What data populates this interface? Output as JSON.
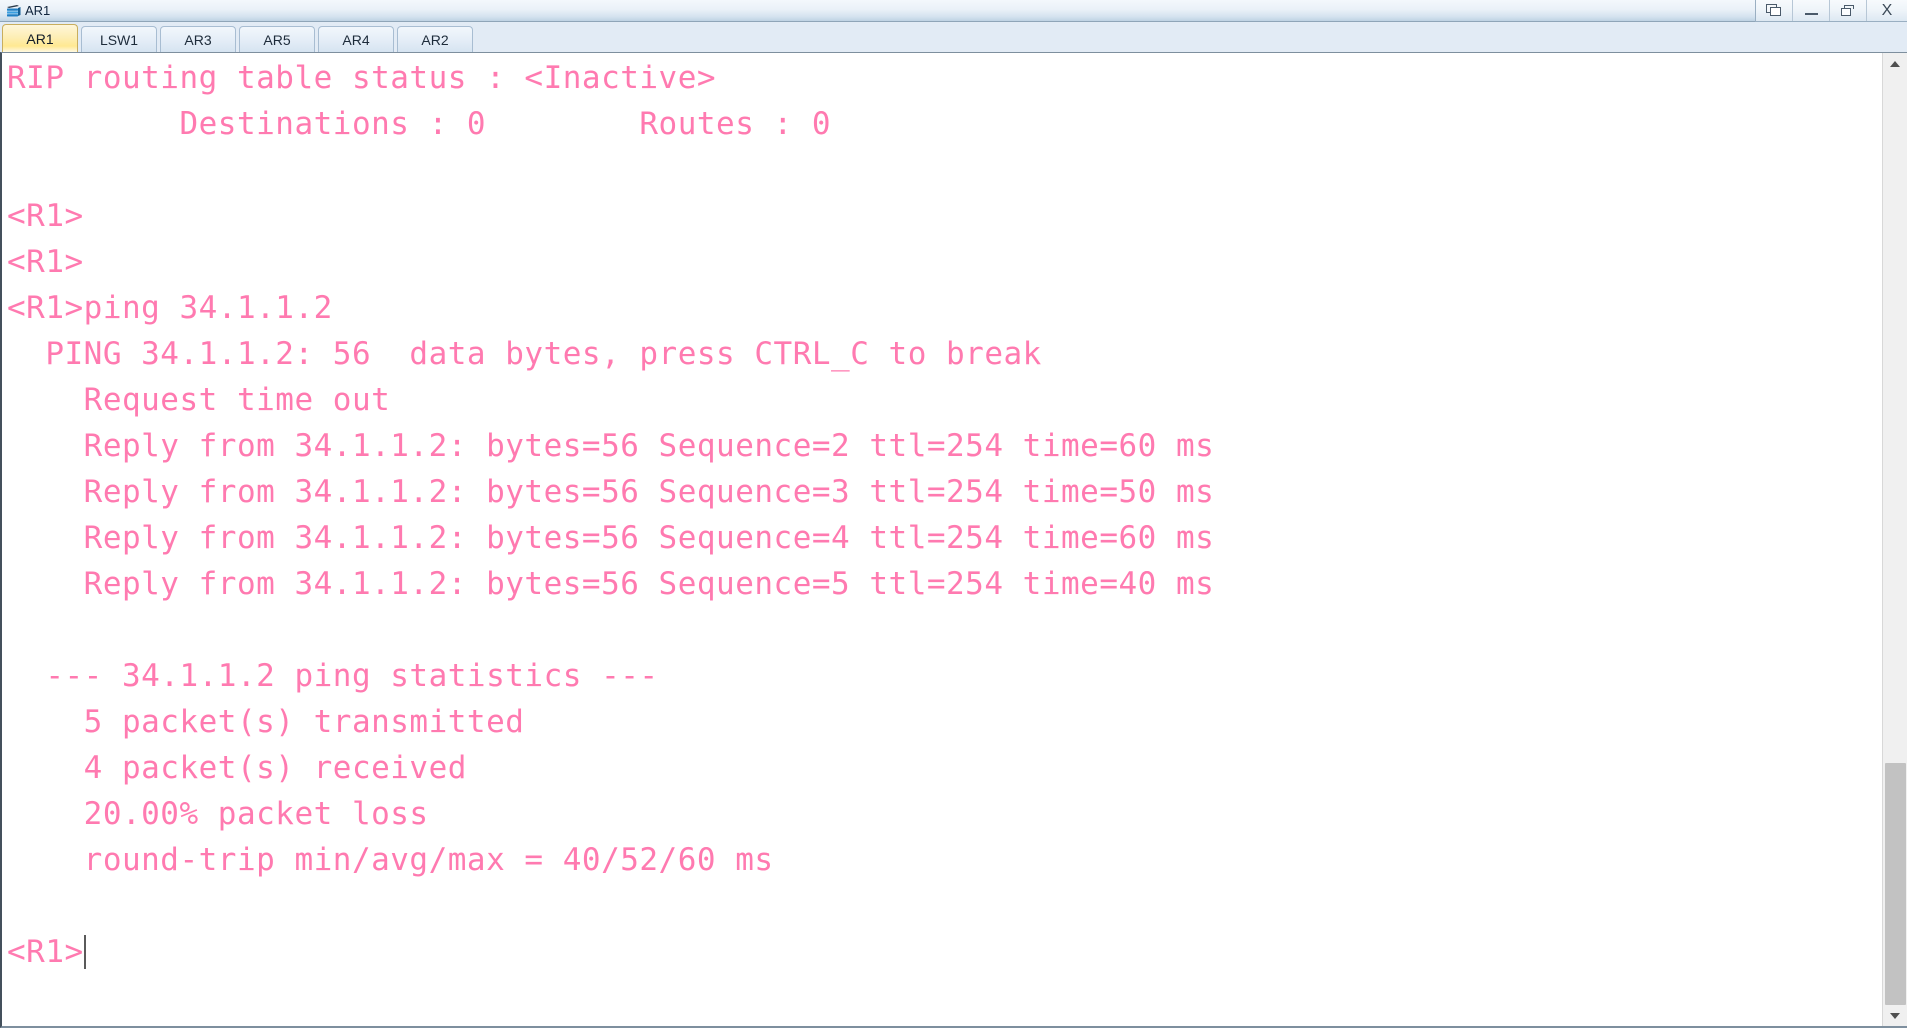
{
  "window": {
    "title": "AR1",
    "icon": "router-icon",
    "controls": [
      {
        "name": "cascade-windows-button",
        "label": "",
        "icon": "cascade-windows-icon"
      },
      {
        "name": "minimize-button",
        "label": "",
        "icon": "minimize-icon"
      },
      {
        "name": "restore-button",
        "label": "",
        "icon": "restore-icon"
      },
      {
        "name": "close-button",
        "label": "X",
        "icon": "close-icon"
      }
    ]
  },
  "tabs": [
    {
      "label": "AR1",
      "active": true
    },
    {
      "label": "LSW1",
      "active": false
    },
    {
      "label": "AR3",
      "active": false
    },
    {
      "label": "AR5",
      "active": false
    },
    {
      "label": "AR4",
      "active": false
    },
    {
      "label": "AR2",
      "active": false
    }
  ],
  "terminal": {
    "text_color": "#ff7ab0",
    "background_color": "#ffffff",
    "lines": [
      "RIP routing table status : <Inactive>",
      "         Destinations : 0        Routes : 0",
      "",
      "<R1>",
      "<R1>",
      "<R1>ping 34.1.1.2",
      "  PING 34.1.1.2: 56  data bytes, press CTRL_C to break",
      "    Request time out",
      "    Reply from 34.1.1.2: bytes=56 Sequence=2 ttl=254 time=60 ms",
      "    Reply from 34.1.1.2: bytes=56 Sequence=3 ttl=254 time=50 ms",
      "    Reply from 34.1.1.2: bytes=56 Sequence=4 ttl=254 time=60 ms",
      "    Reply from 34.1.1.2: bytes=56 Sequence=5 ttl=254 time=40 ms",
      "",
      "  --- 34.1.1.2 ping statistics ---",
      "    5 packet(s) transmitted",
      "    4 packet(s) received",
      "    20.00% packet loss",
      "    round-trip min/avg/max = 40/52/60 ms",
      ""
    ],
    "prompt": "<R1>"
  },
  "scrollbar": {
    "up_arrow": "scroll-up-icon",
    "down_arrow": "scroll-down-icon",
    "thumb_top_percent": 74,
    "thumb_height_percent": 26
  }
}
